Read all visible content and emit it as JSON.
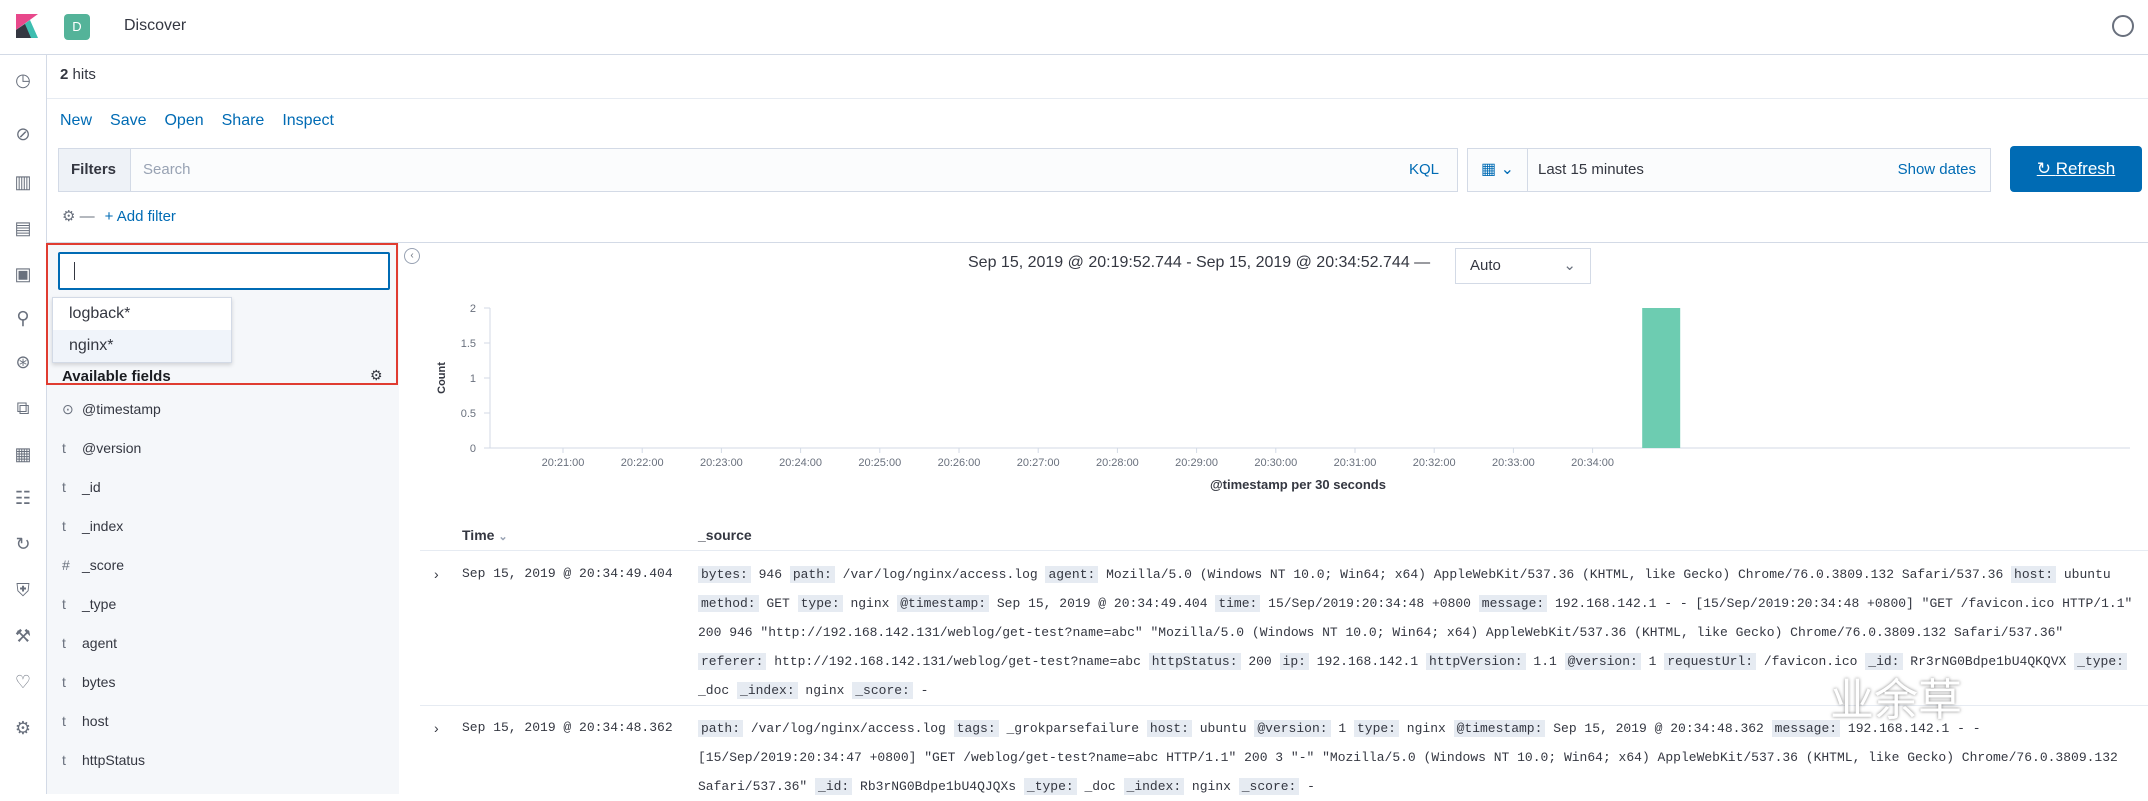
{
  "header": {
    "space_badge": "D",
    "app_title": "Discover"
  },
  "hits": {
    "count": "2",
    "label": "hits"
  },
  "menu": [
    "New",
    "Save",
    "Open",
    "Share",
    "Inspect"
  ],
  "query": {
    "filters_label": "Filters",
    "search_placeholder": "Search",
    "kql_label": "KQL"
  },
  "time": {
    "range": "Last 15 minutes",
    "show_dates": "Show dates",
    "refresh_label": "Refresh"
  },
  "filter_bar": {
    "add_filter": "+ Add filter"
  },
  "sidebar": {
    "index_options": [
      "logback*",
      "nginx*"
    ],
    "available_fields_label": "Available fields",
    "fields": [
      {
        "type": "⊙",
        "name": "@timestamp"
      },
      {
        "type": "t",
        "name": "@version"
      },
      {
        "type": "t",
        "name": "_id"
      },
      {
        "type": "t",
        "name": "_index"
      },
      {
        "type": "#",
        "name": "_score"
      },
      {
        "type": "t",
        "name": "_type"
      },
      {
        "type": "t",
        "name": "agent"
      },
      {
        "type": "t",
        "name": "bytes"
      },
      {
        "type": "t",
        "name": "host"
      },
      {
        "type": "t",
        "name": "httpStatus"
      }
    ]
  },
  "chart_header": {
    "range_label": "Sep 15, 2019 @ 20:19:52.744 - Sep 15, 2019 @ 20:34:52.744 —",
    "interval": "Auto"
  },
  "chart_data": {
    "type": "bar",
    "ylabel": "Count",
    "xlabel": "@timestamp per 30 seconds",
    "ylim": [
      0,
      2
    ],
    "yticks": [
      "0",
      "0.5",
      "1",
      "1.5",
      "2"
    ],
    "xticks": [
      "20:21:00",
      "20:22:00",
      "20:23:00",
      "20:24:00",
      "20:25:00",
      "20:26:00",
      "20:27:00",
      "20:28:00",
      "20:29:00",
      "20:30:00",
      "20:31:00",
      "20:32:00",
      "20:33:00",
      "20:34:00"
    ],
    "bars": [
      {
        "x": "20:34:30",
        "value": 2
      }
    ],
    "bar_color": "#6dccb1"
  },
  "table": {
    "col_time": "Time",
    "col_source": "_source",
    "rows": [
      {
        "time": "Sep 15, 2019 @ 20:34:49.404",
        "fields": [
          [
            "bytes:",
            "946"
          ],
          [
            "path:",
            "/var/log/nginx/access.log"
          ],
          [
            "agent:",
            "Mozilla/5.0 (Windows NT 10.0; Win64; x64) AppleWebKit/537.36 (KHTML, like Gecko) Chrome/76.0.3809.132 Safari/537.36"
          ],
          [
            "host:",
            "ubuntu"
          ],
          [
            "method:",
            "GET"
          ],
          [
            "type:",
            "nginx"
          ],
          [
            "@timestamp:",
            "Sep 15, 2019 @ 20:34:49.404"
          ],
          [
            "time:",
            "15/Sep/2019:20:34:48 +0800"
          ],
          [
            "message:",
            "192.168.142.1 - - [15/Sep/2019:20:34:48 +0800] \"GET /favicon.ico HTTP/1.1\" 200 946 \"http://192.168.142.131/weblog/get-test?name=abc\" \"Mozilla/5.0 (Windows NT 10.0; Win64; x64) AppleWebKit/537.36 (KHTML, like Gecko) Chrome/76.0.3809.132 Safari/537.36\""
          ],
          [
            "referer:",
            "http://192.168.142.131/weblog/get-test?name=abc"
          ],
          [
            "httpStatus:",
            "200"
          ],
          [
            "ip:",
            "192.168.142.1"
          ],
          [
            "httpVersion:",
            "1.1"
          ],
          [
            "@version:",
            "1"
          ],
          [
            "requestUrl:",
            "/favicon.ico"
          ],
          [
            "_id:",
            "Rr3rNG0Bdpe1bU4QKQVX"
          ],
          [
            "_type:",
            "_doc"
          ],
          [
            "_index:",
            "nginx"
          ],
          [
            "_score:",
            "-"
          ]
        ]
      },
      {
        "time": "Sep 15, 2019 @ 20:34:48.362",
        "fields": [
          [
            "path:",
            "/var/log/nginx/access.log"
          ],
          [
            "tags:",
            "_grokparsefailure"
          ],
          [
            "host:",
            "ubuntu"
          ],
          [
            "@version:",
            "1"
          ],
          [
            "type:",
            "nginx"
          ],
          [
            "@timestamp:",
            "Sep 15, 2019 @ 20:34:48.362"
          ],
          [
            "message:",
            "192.168.142.1 - - [15/Sep/2019:20:34:47 +0800] \"GET /weblog/get-test?name=abc HTTP/1.1\" 200 3 \"-\" \"Mozilla/5.0 (Windows NT 10.0; Win64; x64) AppleWebKit/537.36 (KHTML, like Gecko) Chrome/76.0.3809.132 Safari/537.36\""
          ],
          [
            "_id:",
            "Rb3rNG0Bdpe1bU4QJQXs"
          ],
          [
            "_type:",
            "_doc"
          ],
          [
            "_index:",
            "nginx"
          ],
          [
            "_score:",
            "-"
          ]
        ]
      }
    ]
  },
  "watermark": "业余草"
}
